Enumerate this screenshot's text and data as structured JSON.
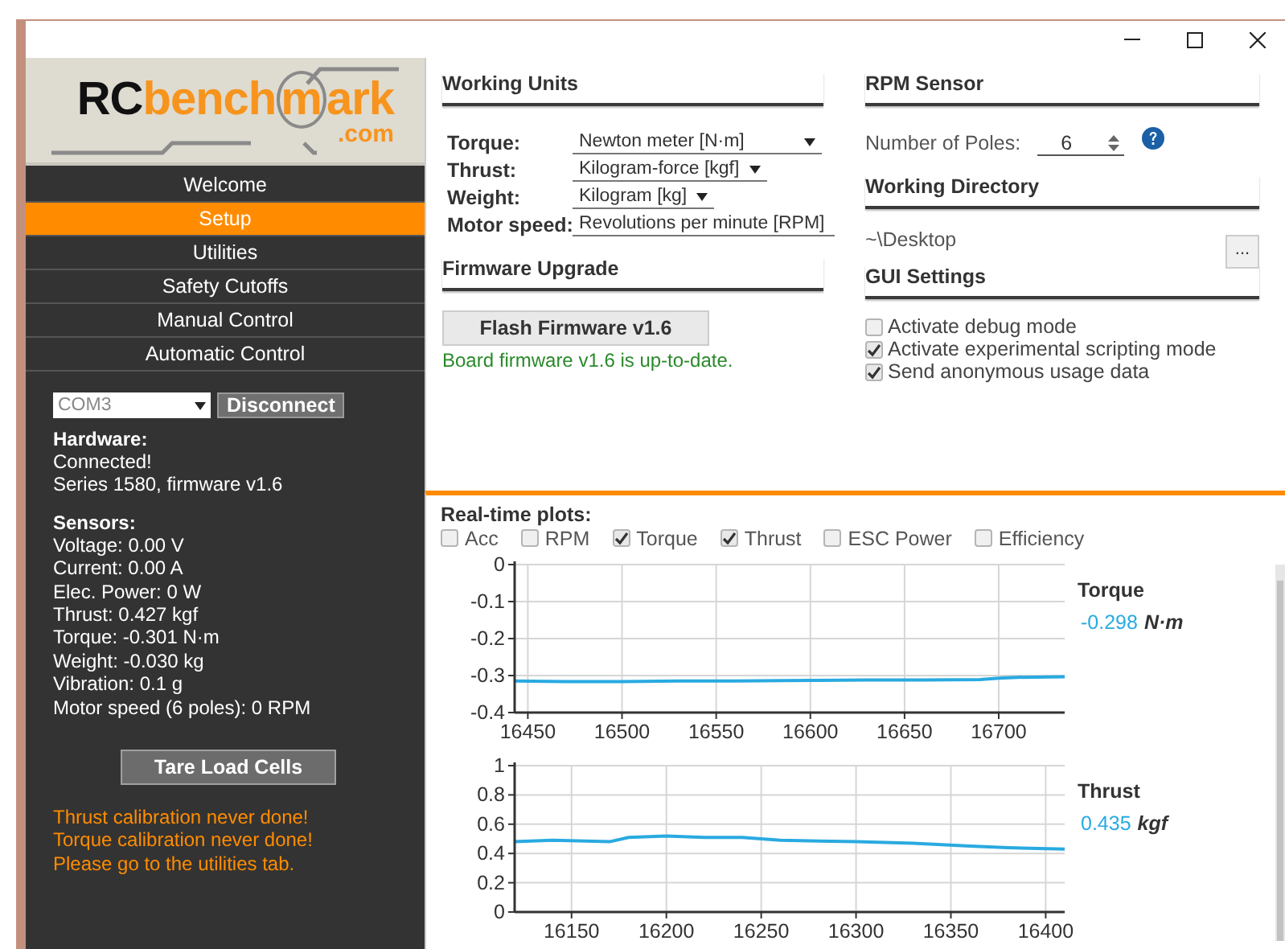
{
  "logo": {
    "parts": [
      "RC",
      "bench",
      "m",
      "ark"
    ],
    "domain": ".com"
  },
  "nav": [
    {
      "label": "Welcome",
      "selected": false
    },
    {
      "label": "Setup",
      "selected": true
    },
    {
      "label": "Utilities",
      "selected": false
    },
    {
      "label": "Safety Cutoffs",
      "selected": false
    },
    {
      "label": "Manual Control",
      "selected": false
    },
    {
      "label": "Automatic Control",
      "selected": false
    }
  ],
  "connection": {
    "port": "COM3",
    "button": "Disconnect"
  },
  "hardware": {
    "title": "Hardware:",
    "lines": [
      "Connected!",
      "Series 1580, firmware v1.6"
    ]
  },
  "sensors": {
    "title": "Sensors:",
    "lines": [
      "Voltage: 0.00 V",
      "Current: 0.00 A",
      "Elec. Power: 0 W",
      "Thrust: 0.427 kgf",
      "Torque: -0.301 N·m",
      "Weight: -0.030 kg",
      "Vibration: 0.1 g",
      "Motor speed (6 poles): 0 RPM"
    ]
  },
  "tare_button": "Tare Load Cells",
  "warnings": [
    "Thrust calibration never done!",
    "Torque calibration never done!",
    "Please go to the utilities tab."
  ],
  "working_units": {
    "title": "Working Units",
    "rows": [
      {
        "label": "Torque:",
        "value": "Newton meter [N·m]"
      },
      {
        "label": "Thrust:",
        "value": "Kilogram-force [kgf]"
      },
      {
        "label": "Weight:",
        "value": "Kilogram [kg]"
      },
      {
        "label": "Motor speed:",
        "value": "Revolutions per minute [RPM]"
      }
    ]
  },
  "firmware": {
    "title": "Firmware Upgrade",
    "button": "Flash Firmware v1.6",
    "status": "Board firmware v1.6 is up-to-date."
  },
  "rpm_sensor": {
    "title": "RPM Sensor",
    "label": "Number of Poles:",
    "value": "6"
  },
  "working_directory": {
    "title": "Working Directory",
    "path": "~\\Desktop",
    "button": "..."
  },
  "gui_settings": {
    "title": "GUI Settings",
    "options": [
      {
        "label": "Activate debug mode",
        "checked": false
      },
      {
        "label": "Activate experimental scripting mode",
        "checked": true
      },
      {
        "label": "Send anonymous usage data",
        "checked": true
      }
    ]
  },
  "plots": {
    "title": "Real-time plots:",
    "toggles": [
      {
        "label": "Acc",
        "checked": false
      },
      {
        "label": "RPM",
        "checked": false
      },
      {
        "label": "Torque",
        "checked": true
      },
      {
        "label": "Thrust",
        "checked": true
      },
      {
        "label": "ESC Power",
        "checked": false
      },
      {
        "label": "Efficiency",
        "checked": false
      }
    ],
    "charts": [
      {
        "reading": "-0.298",
        "unit": "N·m",
        "chart_data": {
          "type": "line",
          "grid": true,
          "xlim": [
            16443,
            16735
          ],
          "ylim": [
            -0.4,
            0
          ],
          "xticks": [
            16450,
            16500,
            16550,
            16600,
            16650,
            16700
          ],
          "yticks": [
            0,
            -0.1,
            -0.2,
            -0.3,
            -0.4
          ],
          "x": [
            16443,
            16470,
            16500,
            16530,
            16560,
            16600,
            16630,
            16660,
            16690,
            16700,
            16710,
            16735
          ],
          "series": [
            {
              "name": "Torque",
              "color": "#29aae1",
              "values": [
                -0.315,
                -0.316,
                -0.316,
                -0.315,
                -0.315,
                -0.313,
                -0.312,
                -0.312,
                -0.311,
                -0.307,
                -0.305,
                -0.303
              ]
            }
          ]
        }
      },
      {
        "reading": "0.435",
        "unit": "kgf",
        "chart_data": {
          "type": "line",
          "grid": true,
          "xlim": [
            16120,
            16410
          ],
          "ylim": [
            0,
            1
          ],
          "xticks": [
            16150,
            16200,
            16250,
            16300,
            16350,
            16400
          ],
          "yticks": [
            1,
            0.8,
            0.6,
            0.4,
            0.2,
            0
          ],
          "x": [
            16120,
            16140,
            16170,
            16180,
            16200,
            16220,
            16240,
            16260,
            16300,
            16330,
            16360,
            16380,
            16410
          ],
          "series": [
            {
              "name": "Thrust",
              "color": "#29aae1",
              "values": [
                0.48,
                0.49,
                0.48,
                0.51,
                0.52,
                0.51,
                0.51,
                0.49,
                0.48,
                0.47,
                0.45,
                0.44,
                0.43
              ]
            }
          ]
        }
      }
    ]
  }
}
